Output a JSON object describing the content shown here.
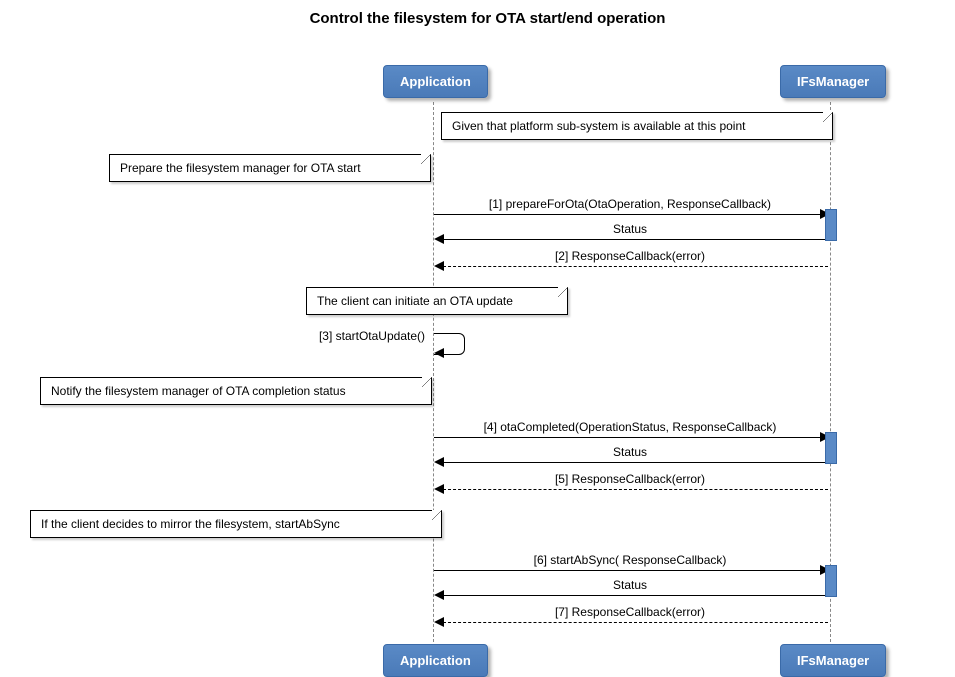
{
  "title": "Control the filesystem for OTA start/end operation",
  "participants": {
    "app": "Application",
    "fs": "IFsManager"
  },
  "notes": {
    "n0": "Given that platform sub-system is available at this point",
    "n1": "Prepare the filesystem manager for OTA start",
    "n2": "The client can initiate an OTA update",
    "n3": "Notify the filesystem manager of OTA completion status",
    "n4": "If the client decides to mirror the filesystem, startAbSync"
  },
  "messages": {
    "m1": "[1] prepareForOta(OtaOperation, ResponseCallback)",
    "m1r": "Status",
    "m2": "[2] ResponseCallback(error)",
    "m3": "[3] startOtaUpdate()",
    "m4": "[4] otaCompleted(OperationStatus, ResponseCallback)",
    "m4r": "Status",
    "m5": "[5] ResponseCallback(error)",
    "m6": "[6] startAbSync( ResponseCallback)",
    "m6r": "Status",
    "m7": "[7] ResponseCallback(error)"
  },
  "chart_data": {
    "type": "sequence-diagram",
    "title": "Control the filesystem for OTA start/end operation",
    "participants": [
      "Application",
      "IFsManager"
    ],
    "interactions": [
      {
        "type": "note",
        "over": [
          "Application",
          "IFsManager"
        ],
        "text": "Given that platform sub-system is available at this point"
      },
      {
        "type": "note",
        "over": [
          "Application"
        ],
        "text": "Prepare the filesystem manager for OTA start"
      },
      {
        "seq": 1,
        "from": "Application",
        "to": "IFsManager",
        "label": "prepareForOta(OtaOperation, ResponseCallback)",
        "style": "solid"
      },
      {
        "from": "IFsManager",
        "to": "Application",
        "label": "Status",
        "style": "solid",
        "return": true
      },
      {
        "seq": 2,
        "from": "IFsManager",
        "to": "Application",
        "label": "ResponseCallback(error)",
        "style": "dashed"
      },
      {
        "type": "note",
        "over": [
          "Application"
        ],
        "text": "The client can initiate an OTA update"
      },
      {
        "seq": 3,
        "from": "Application",
        "to": "Application",
        "label": "startOtaUpdate()",
        "style": "solid",
        "self": true
      },
      {
        "type": "note",
        "over": [
          "Application"
        ],
        "text": "Notify the filesystem manager of OTA completion status"
      },
      {
        "seq": 4,
        "from": "Application",
        "to": "IFsManager",
        "label": "otaCompleted(OperationStatus, ResponseCallback)",
        "style": "solid"
      },
      {
        "from": "IFsManager",
        "to": "Application",
        "label": "Status",
        "style": "solid",
        "return": true
      },
      {
        "seq": 5,
        "from": "IFsManager",
        "to": "Application",
        "label": "ResponseCallback(error)",
        "style": "dashed"
      },
      {
        "type": "note",
        "over": [
          "Application"
        ],
        "text": "If the client decides to mirror the filesystem, startAbSync"
      },
      {
        "seq": 6,
        "from": "Application",
        "to": "IFsManager",
        "label": "startAbSync( ResponseCallback)",
        "style": "solid"
      },
      {
        "from": "IFsManager",
        "to": "Application",
        "label": "Status",
        "style": "solid",
        "return": true
      },
      {
        "seq": 7,
        "from": "IFsManager",
        "to": "Application",
        "label": "ResponseCallback(error)",
        "style": "dashed"
      }
    ]
  }
}
